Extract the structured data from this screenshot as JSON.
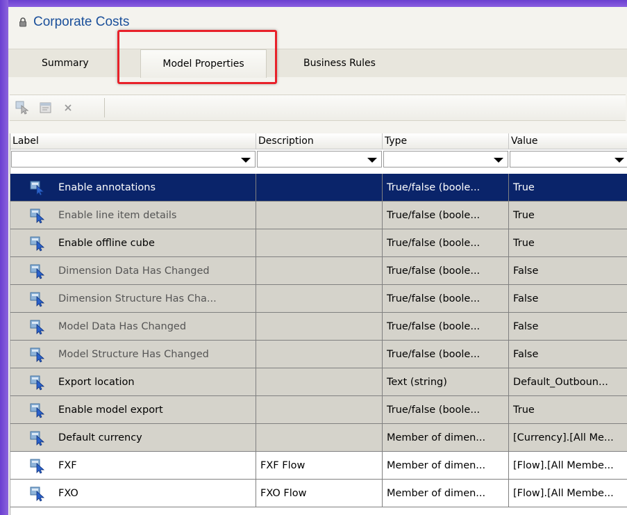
{
  "window": {
    "title": "Corporate Costs"
  },
  "tabs": [
    {
      "label": "Summary"
    },
    {
      "label": "Model Properties"
    },
    {
      "label": "Business Rules"
    }
  ],
  "toolbar": {
    "buttons": [
      "select-icon",
      "properties-icon",
      "delete-icon"
    ]
  },
  "grid": {
    "columns": [
      "Label",
      "Description",
      "Type",
      "Value"
    ],
    "rows": [
      {
        "label": "Enable annotations",
        "description": "",
        "type": "True/false (boole...",
        "value": "True",
        "state": "selected"
      },
      {
        "label": "Enable line item details",
        "description": "",
        "type": "True/false (boole...",
        "value": "True",
        "state": "dim"
      },
      {
        "label": "Enable offline cube",
        "description": "",
        "type": "True/false (boole...",
        "value": "True",
        "state": "grey"
      },
      {
        "label": "Dimension Data Has Changed",
        "description": "",
        "type": "True/false (boole...",
        "value": "False",
        "state": "dim"
      },
      {
        "label": "Dimension Structure Has Cha...",
        "description": "",
        "type": "True/false (boole...",
        "value": "False",
        "state": "dim"
      },
      {
        "label": "Model Data Has Changed",
        "description": "",
        "type": "True/false (boole...",
        "value": "False",
        "state": "dim"
      },
      {
        "label": "Model Structure Has Changed",
        "description": "",
        "type": "True/false (boole...",
        "value": "False",
        "state": "dim"
      },
      {
        "label": "Export location",
        "description": "",
        "type": "Text (string)",
        "value": "Default_Outboun...",
        "state": "grey"
      },
      {
        "label": "Enable model export",
        "description": "",
        "type": "True/false (boole...",
        "value": "True",
        "state": "grey"
      },
      {
        "label": "Default currency",
        "description": "",
        "type": "Member of dimen...",
        "value": "[Currency].[All Me...",
        "state": "grey"
      },
      {
        "label": "FXF",
        "description": "FXF Flow",
        "type": "Member of dimen...",
        "value": "[Flow].[All Membe...",
        "state": "white"
      },
      {
        "label": "FXO",
        "description": "FXO Flow",
        "type": "Member of dimen...",
        "value": "[Flow].[All Membe...",
        "state": "white"
      }
    ]
  },
  "colors": {
    "selection": "#0a246a",
    "title": "#1a4f9a",
    "highlight": "#e8212a",
    "frame": "#7b4fd6"
  }
}
